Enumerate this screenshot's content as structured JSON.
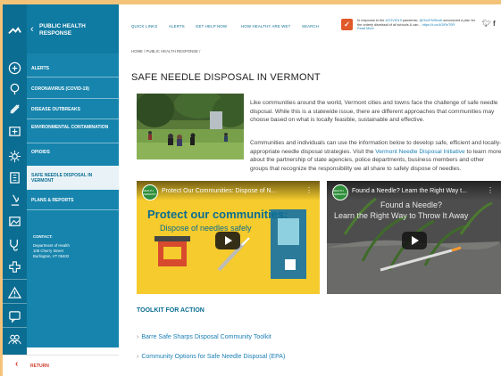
{
  "nav": {
    "section_title": "PUBLIC HEALTH RESPONSE",
    "items": [
      {
        "label": "ALERTS"
      },
      {
        "label": "CORONAVIRUS (COVID-19)"
      },
      {
        "label": "DISEASE OUTBREAKS"
      },
      {
        "label": "ENVIRONMENTAL CONTAMINATION"
      },
      {
        "label": "OPIOIDS"
      },
      {
        "label": "SAFE NEEDLE DISPOSAL IN VERMONT"
      },
      {
        "label": "PLANS & REPORTS"
      }
    ],
    "contact": {
      "label": "CONTACT:",
      "line1": "Department of Health",
      "line2": "108 Cherry Street",
      "line3": "Burlington, VT 05402"
    },
    "return_label": "RETURN"
  },
  "top_links": [
    "QUICK LINKS",
    "ALERTS",
    "GET HELP NOW",
    "HOW HEALTHY ARE WE?",
    "SEARCH"
  ],
  "tweet": {
    "text_before": "In response to the ",
    "tag": "#COVID19",
    "text_mid": " pandemic, ",
    "handle": "@GovPhilScott",
    "text_after": " announced a plan for the orderly dismissal of all schools & can...",
    "url": "https://t.co/4GiRnT0R",
    "more": "Read More"
  },
  "breadcrumb": "HOME / PUBLIC HEALTH RESPONSE /",
  "page_title": "SAFE NEEDLE DISPOSAL IN VERMONT",
  "intro_paragraph": "Like communities around the world, Vermont cities and towns face the challenge of safe needle disposal. While this is a statewide issue, there are different approaches that communities may choose based on what is locally feasible, sustainable and effective.",
  "second_paragraph": {
    "before": "Communities and individuals can use the information below to develop safe, efficient and locally-appropriate needle disposal strategies. Visit the ",
    "link": "Vermont Needle Disposal Initiative",
    "after": " to learn more about the partnership of state agencies, police departments, business members and other groups that recognize the responsibility we all share to safely dispose of needles."
  },
  "videos": [
    {
      "title": "Protect Our Communities: Dispose of N...",
      "headline": "Protect our communities:",
      "sub": "Dispose of needles safely",
      "logo": "HEALTH VERMONT"
    },
    {
      "title": "Found a Needle? Learn the Right Way t...",
      "overlay1": "Found a Needle?",
      "overlay2": "Learn the Right Way to Throw It Away",
      "logo": "HEALTH VERMONT"
    }
  ],
  "toolkit_heading": "TOOLKIT FOR ACTION",
  "toolkit_links": [
    "Barre Safe Sharps Disposal Community Toolkit",
    "Community Options for Safe Needle Disposal (EPA)"
  ],
  "colors": {
    "rail": "#0b6d92",
    "nav": "#1684ad",
    "link": "#1a7fb5",
    "accent": "#d23b2a",
    "border": "#f4c37a"
  },
  "icons": [
    "vermont-logo-icon",
    "alert-icon",
    "virus-icon",
    "bug-icon",
    "contamination-icon",
    "sun-icon",
    "building-icon",
    "microscope-icon",
    "image-icon",
    "stethoscope-icon",
    "plus-icon",
    "warning-icon",
    "chat-icon",
    "people-icon"
  ]
}
